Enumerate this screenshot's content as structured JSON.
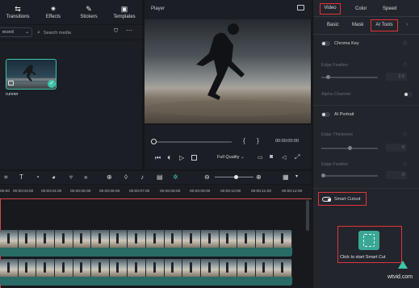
{
  "top_tabs": [
    {
      "label": "Transitions",
      "icon": "transitions-icon"
    },
    {
      "label": "Effects",
      "icon": "effects-icon"
    },
    {
      "label": "Stickers",
      "icon": "stickers-icon"
    },
    {
      "label": "Templates",
      "icon": "templates-icon"
    }
  ],
  "media": {
    "record_label": "ecord",
    "search_placeholder": "Search media",
    "item_name": "runner"
  },
  "player": {
    "title": "Player",
    "timecode": "00:00:00:00",
    "quality": "Full Quality",
    "brace_left": "{",
    "brace_right": "}"
  },
  "right_panel": {
    "tabs": [
      "Video",
      "Color",
      "Speed"
    ],
    "subtabs": [
      "Basic",
      "Mask",
      "AI Tools"
    ],
    "chroma_key": "Chroma Key",
    "edge_feather_1": "Edge Feather",
    "edge_feather_1_value": "2.0",
    "alpha_channel": "Alpha Channel",
    "ai_portrait": "AI Portrait",
    "edge_thickness": "Edge Thickness",
    "edge_thickness_value": "0",
    "edge_feather_2": "Edge Feather",
    "edge_feather_2_value": "0",
    "smart_cutout": "Smart Cutout",
    "smart_cutout_button": "Click to start Smart Cut",
    "watermark": "wtvid.com"
  },
  "timeline": {
    "ticks": [
      "00:00",
      "00:00:03:00",
      "00:00:04:00",
      "00:00:05:00",
      "00:00:06:00",
      "00:00:07:00",
      "00:00:08:00",
      "00:00:09:00",
      "00:00:10:00",
      "00:00:11:00",
      "00:00:12:00"
    ]
  },
  "colors": {
    "accent": "#3fc3a9",
    "highlight_red": "#e0353b",
    "playhead": "#d64550"
  }
}
